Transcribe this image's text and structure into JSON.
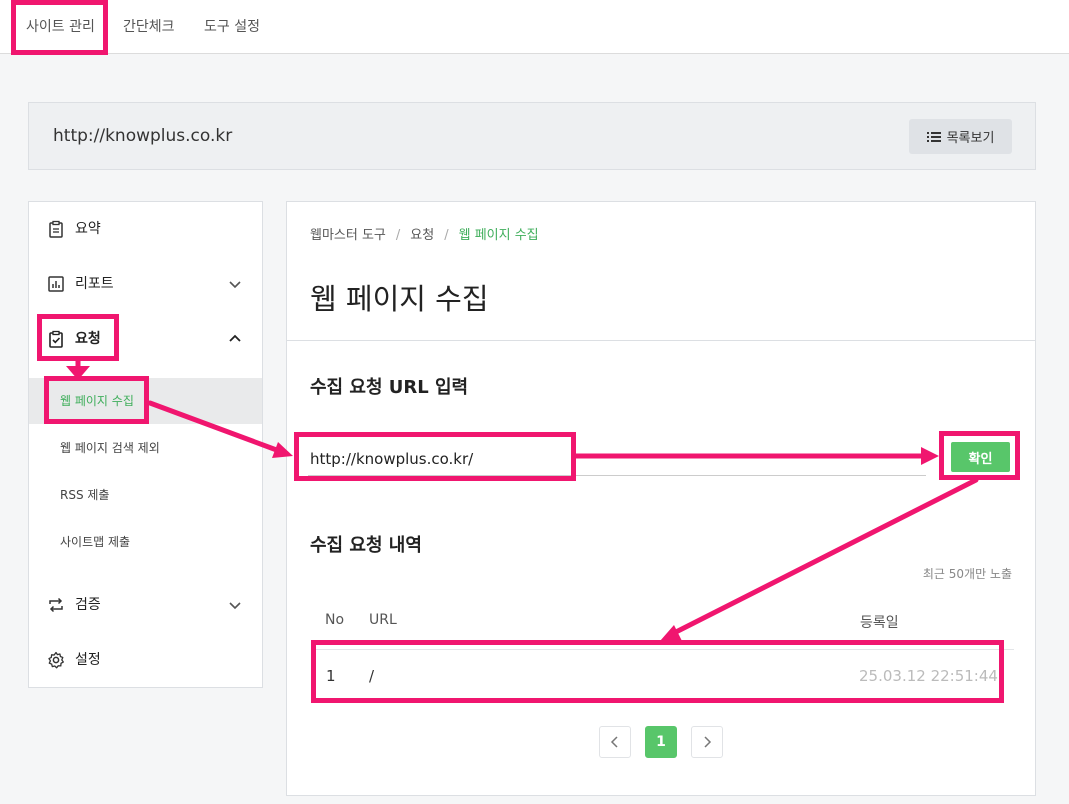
{
  "topnav": {
    "tabs": [
      {
        "label": "사이트 관리"
      },
      {
        "label": "간단체크"
      },
      {
        "label": "도구 설정"
      }
    ]
  },
  "site": {
    "url": "http://knowplus.co.kr",
    "list_button": "목록보기"
  },
  "sidebar": {
    "items": [
      {
        "label": "요약",
        "icon": "clipboard-icon"
      },
      {
        "label": "리포트",
        "icon": "bar-chart-icon"
      },
      {
        "label": "요청",
        "icon": "clipboard-check-icon"
      },
      {
        "label": "검증",
        "icon": "repeat-icon"
      },
      {
        "label": "설정",
        "icon": "gear-icon"
      }
    ],
    "subitems": [
      {
        "label": "웹 페이지 수집"
      },
      {
        "label": "웹 페이지 검색 제외"
      },
      {
        "label": "RSS 제출"
      },
      {
        "label": "사이트맵 제출"
      }
    ]
  },
  "main": {
    "breadcrumb": [
      "웹마스터 도구",
      "요청",
      "웹 페이지 수집"
    ],
    "title": "웹 페이지 수집",
    "input_section_title": "수집 요청 URL 입력",
    "url_value": "http://knowplus.co.kr/",
    "confirm_label": "확인",
    "history_title": "수집 요청 내역",
    "history_note": "최근 50개만 노출",
    "table": {
      "headers": [
        "No",
        "URL",
        "등록일"
      ],
      "rows": [
        {
          "no": "1",
          "url": "/",
          "date": "25.03.12 22:51:44"
        }
      ]
    },
    "pagination": {
      "current": "1",
      "prev": "‹",
      "next": "›"
    }
  },
  "colors": {
    "accent_green": "#58c66a",
    "annotation_pink": "#f0166f"
  }
}
